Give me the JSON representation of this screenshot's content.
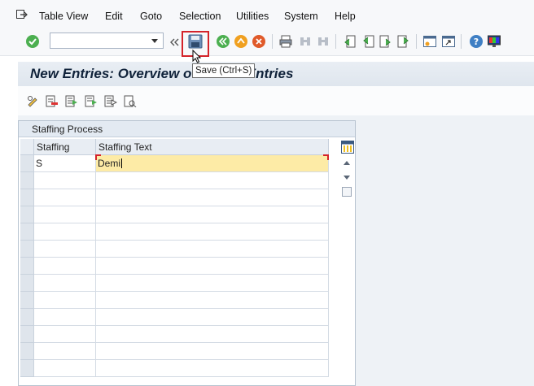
{
  "menu": {
    "items": [
      {
        "label": "Table View"
      },
      {
        "label": "Edit"
      },
      {
        "label": "Goto"
      },
      {
        "label": "Selection"
      },
      {
        "label": "Utilities"
      },
      {
        "label": "System"
      },
      {
        "label": "Help"
      }
    ]
  },
  "toolbar": {
    "command_field_value": "",
    "tooltip": "Save   (Ctrl+S)"
  },
  "screen": {
    "title": "New Entries: Overview of Added Entries"
  },
  "panel": {
    "title": "Staffing Process",
    "columns": [
      "Staffing",
      "Staffing Text"
    ],
    "rows": [
      {
        "staffing": "S",
        "text": "Demi"
      }
    ],
    "empty_rows": 12
  },
  "colors": {
    "accent_red": "#d4232a",
    "active_cell": "#fdeba6",
    "title_text": "#10223a"
  }
}
